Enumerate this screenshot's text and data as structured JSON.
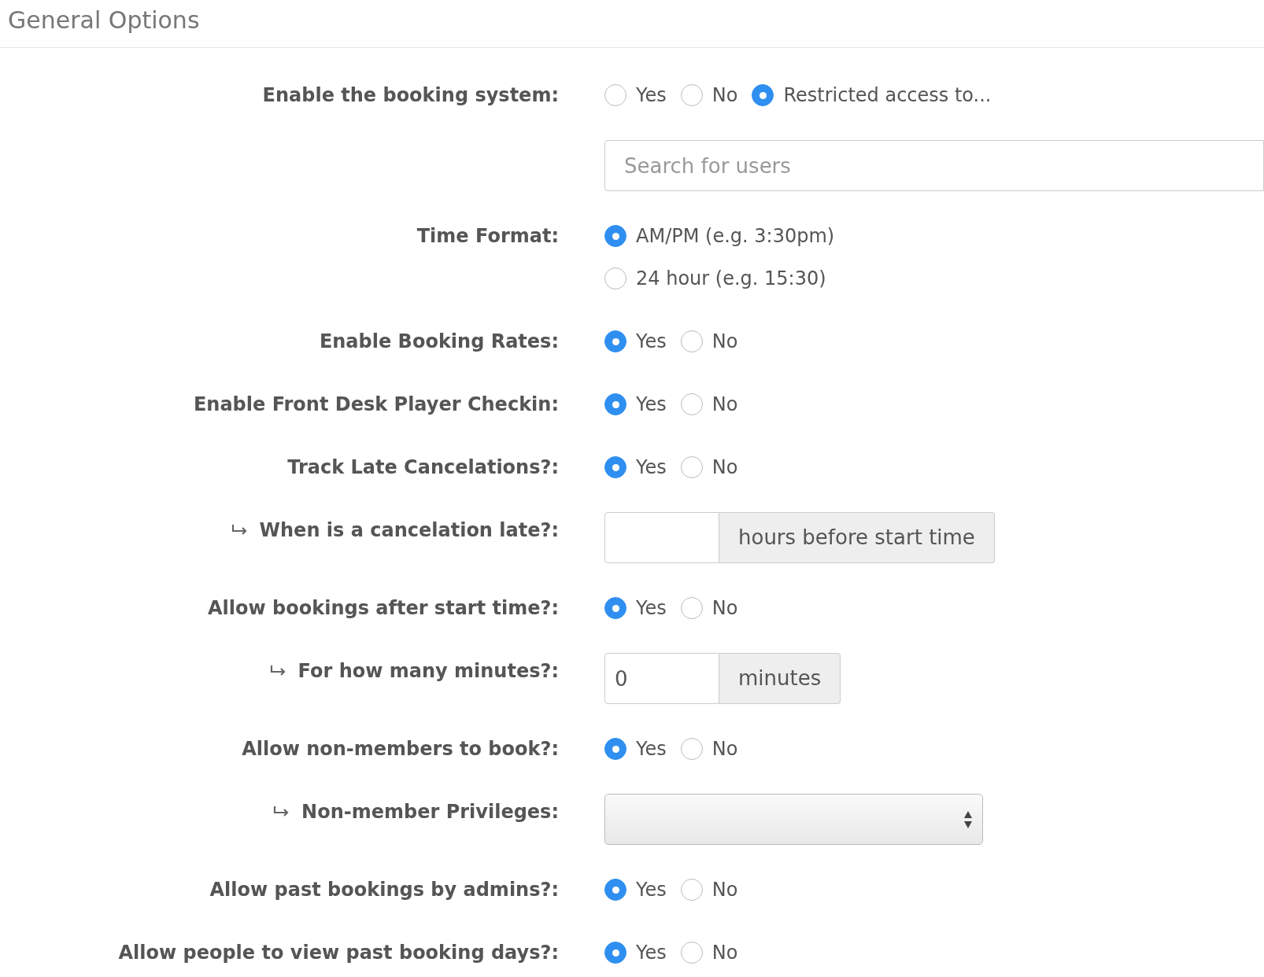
{
  "title": "General Options",
  "fields": [
    {
      "kind": "radio",
      "label": "Enable the booking system:",
      "sub": false,
      "stacked": false,
      "options": [
        {
          "label": "Yes",
          "selected": false
        },
        {
          "label": "No",
          "selected": false
        },
        {
          "label": "Restricted access to...",
          "selected": true
        }
      ]
    },
    {
      "kind": "search",
      "sub": false,
      "placeholder": "Search for users"
    },
    {
      "kind": "radio",
      "label": "Time Format:",
      "sub": false,
      "stacked": true,
      "options": [
        {
          "label": "AM/PM (e.g. 3:30pm)",
          "selected": true
        },
        {
          "label": "24 hour (e.g. 15:30)",
          "selected": false
        }
      ]
    },
    {
      "kind": "radio",
      "label": "Enable Booking Rates:",
      "sub": false,
      "stacked": false,
      "options": [
        {
          "label": "Yes",
          "selected": true
        },
        {
          "label": "No",
          "selected": false
        }
      ]
    },
    {
      "kind": "radio",
      "label": "Enable Front Desk Player Checkin:",
      "sub": false,
      "stacked": false,
      "options": [
        {
          "label": "Yes",
          "selected": true
        },
        {
          "label": "No",
          "selected": false
        }
      ]
    },
    {
      "kind": "radio",
      "label": "Track Late Cancelations?:",
      "sub": false,
      "stacked": false,
      "options": [
        {
          "label": "Yes",
          "selected": true
        },
        {
          "label": "No",
          "selected": false
        }
      ]
    },
    {
      "kind": "addon",
      "label": "When is a cancelation late?:",
      "sub": true,
      "addon": "hours before start time"
    },
    {
      "kind": "radio",
      "label": "Allow bookings after start time?:",
      "sub": false,
      "stacked": false,
      "options": [
        {
          "label": "Yes",
          "selected": true
        },
        {
          "label": "No",
          "selected": false
        }
      ]
    },
    {
      "kind": "addon",
      "label": "For how many minutes?:",
      "sub": true,
      "value": "0",
      "addon": "minutes"
    },
    {
      "kind": "radio",
      "label": "Allow non-members to book?:",
      "sub": false,
      "stacked": false,
      "options": [
        {
          "label": "Yes",
          "selected": true
        },
        {
          "label": "No",
          "selected": false
        }
      ]
    },
    {
      "kind": "select",
      "label": "Non-member Privileges:",
      "sub": true
    },
    {
      "kind": "radio",
      "label": "Allow past bookings by admins?:",
      "sub": false,
      "stacked": false,
      "options": [
        {
          "label": "Yes",
          "selected": true
        },
        {
          "label": "No",
          "selected": false
        }
      ]
    },
    {
      "kind": "radio",
      "label": "Allow people to view past booking days?:",
      "sub": false,
      "stacked": false,
      "options": [
        {
          "label": "Yes",
          "selected": true
        },
        {
          "label": "No",
          "selected": false
        }
      ]
    }
  ]
}
